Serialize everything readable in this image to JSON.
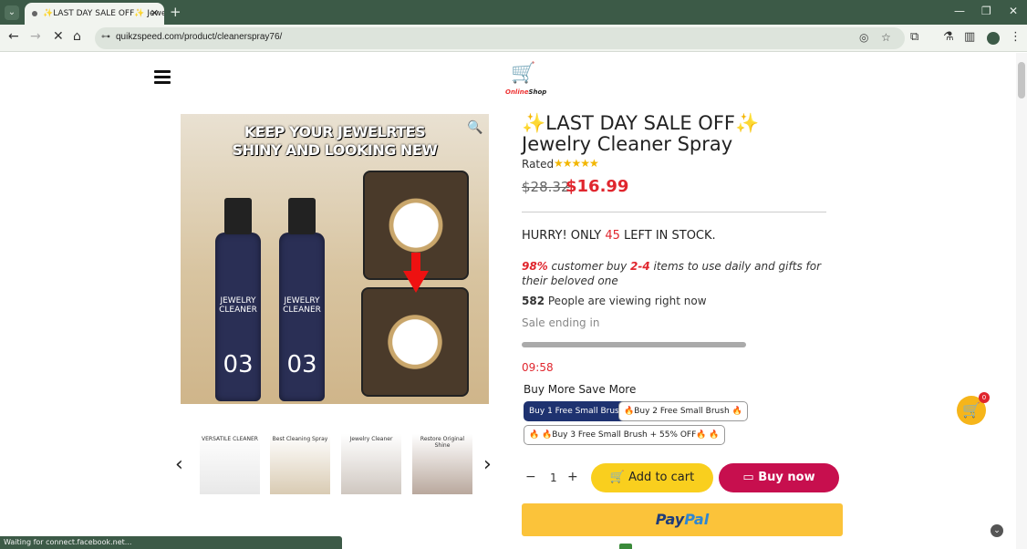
{
  "browser": {
    "tab_title": "✨LAST DAY SALE OFF✨ Jewe",
    "tab_close": "✕",
    "new_tab": "+",
    "url": "quikzspeed.com/product/cleanerspray76/",
    "status_text": "Waiting for connect.facebook.net..."
  },
  "header": {
    "logo_text_1": "Online",
    "logo_text_2": "Shop"
  },
  "gallery": {
    "headline_1": "KEEP YOUR JEWELRTES",
    "headline_2": "SHINY AND LOOKING NEW",
    "bottle_label": "JEWELRY CLEANER",
    "bottle_number": "03",
    "thumbnails": [
      {
        "title": "VERSATILE CLEANER"
      },
      {
        "title": "Best Cleaning Spray"
      },
      {
        "title": "Jewelry Cleaner"
      },
      {
        "title": "Restore Original Shine"
      }
    ]
  },
  "product": {
    "title": "✨LAST DAY SALE OFF✨ Jewelry Cleaner Spray",
    "rated_label": "Rated",
    "rating_stars": 5,
    "stars_text": "★★★★★",
    "old_price": "$28.32",
    "new_price": "$16.99",
    "stock_prefix": "HURRY! ONLY ",
    "stock_count": "45",
    "stock_suffix": " LEFT IN STOCK.",
    "cust_pct": "98%",
    "cust_mid": " customer buy ",
    "cust_range": "2-4",
    "cust_end": " items to use daily and gifts for their beloved one",
    "viewing_count": "582",
    "viewing_text": " People are viewing right now",
    "sale_ending": "Sale ending in",
    "sale_progress": 1.0,
    "timer": "09:58",
    "bundle_heading": "Buy More Save More",
    "bundles": [
      {
        "label": "Buy 1 Free Small Brush",
        "selected": true
      },
      {
        "label": "🔥Buy 2 Free Small Brush 🔥",
        "selected": false
      },
      {
        "label": "🔥 🔥Buy 3 Free Small Brush + 55% OFF🔥 🔥",
        "selected": false
      }
    ],
    "quantity": "1",
    "add_to_cart": "Add to cart",
    "buy_now": "Buy now",
    "paypal_1": "Pay",
    "paypal_2": "Pal"
  },
  "cart": {
    "count": "0"
  },
  "colors": {
    "accent_red": "#e0262e",
    "buy_now": "#c70f4e",
    "add_to_cart": "#f9cf1e",
    "paypal": "#fbc33a",
    "selected_bundle": "#1e3270",
    "chrome": "#3c5a47"
  },
  "icons": [
    "tab-list-icon",
    "back-icon",
    "forward-icon",
    "reload-icon",
    "home-icon",
    "site-info-icon",
    "eye-off-icon",
    "star-icon",
    "extensions-icon",
    "lab-icon",
    "sidebar-icon",
    "profile-icon",
    "menu-dots-icon",
    "hamburger-icon",
    "search-zoom-icon",
    "cart-icon",
    "card-icon",
    "chevron-left-icon",
    "chevron-right-icon",
    "scroll-top-icon"
  ]
}
